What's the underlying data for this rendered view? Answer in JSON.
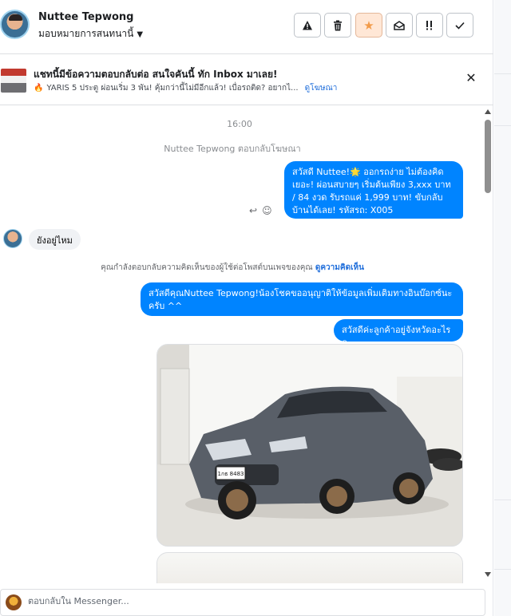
{
  "header": {
    "contact_name": "Nuttee Tepwong",
    "assign_label": "มอบหมายการสนทนานี้",
    "toolbar": {
      "spam_icon": "warning-icon",
      "delete_icon": "trash-icon",
      "star_icon": "star-icon",
      "unread_icon": "envelope-open-icon",
      "follow_up_icon": "follow-up-icon",
      "done_icon": "check-icon"
    },
    "star_color": "#f29b4a"
  },
  "ad": {
    "title": "แชทนี้มีข้อความตอบกลับต่อ สนใจคันนี้ ทัก Inbox มาเลย!",
    "subtitle": "YARIS 5 ประตู ผ่อนเริ่ม 3 พัน! คุ้มกว่านี้ไม่มีอีกแล้ว! เบื่อรถติด? อยากไ...",
    "link": "ดูโฆษณา"
  },
  "conversation": {
    "time": "16:00",
    "replied_notice": "Nuttee Tepwong ตอบกลับโฆษณา",
    "message_1": "สวัสดี Nuttee!🌟 ออกรถง่าย ไม่ต้องคิดเยอะ! ผ่อนสบายๆ เริ่มต้นเพียง 3,xxx บาท / 84 งวด รับรถแค่ 1,999 บาท! ขับกลับบ้านได้เลย! รหัสรถ: X005",
    "incoming_message": "ยังอยู่ไหม",
    "comment_notice": "คุณกำลังตอบกลับความคิดเห็นของผู้ใช้ต่อโพสต์บนเพจของคุณ",
    "comment_link": "ดูความคิดเห็น",
    "message_2": "สวัสดีคุณNuttee Tepwong!น้องโชคขออนุญาติให้ข้อมูลเพิ่มเติมทางอินบ๊อกซ์นะครับ ^^",
    "message_3": "สวัสดีค่ะลูกค้าอยู่จังหวัดอะไรคะ",
    "plate_text": "1กธ 8483",
    "bubble_color": "#0084ff"
  },
  "composer": {
    "placeholder": "ตอบกลับใน Messenger..."
  }
}
